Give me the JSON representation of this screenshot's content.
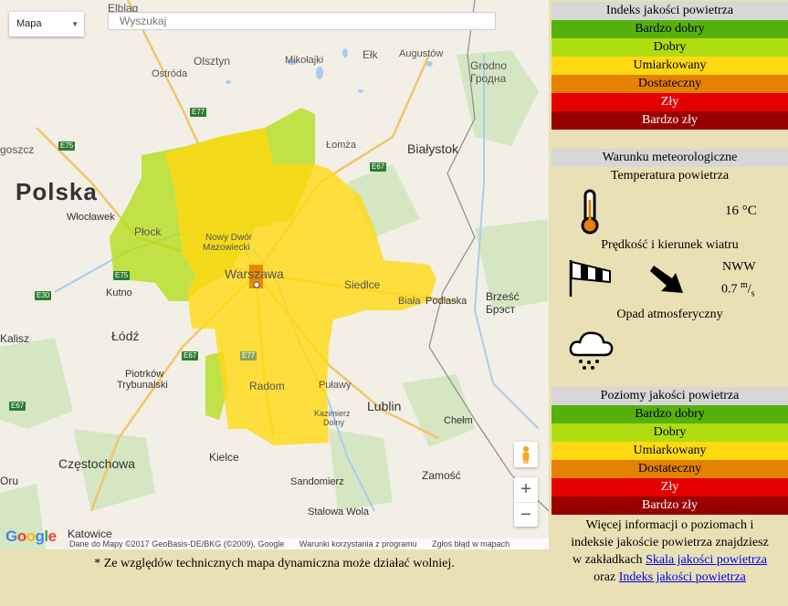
{
  "map": {
    "map_type": "Mapa",
    "search_placeholder": "Wyszukaj",
    "attribution": [
      "Dane do Mapy ©2017 GeoBasis-DE/BKG (©2009), Google",
      "Warunki korzystania z programu",
      "Zgłoś błąd w mapach"
    ],
    "logo": "Google",
    "zoom_in": "+",
    "zoom_out": "−",
    "labels": {
      "elblag": "Elbląg",
      "olsztyn": "Olsztyn",
      "mikolajki": "Mikołajki",
      "elk": "Ełk",
      "augustow": "Augustów",
      "grodno": "Grodno",
      "grodno_ru": "Гродна",
      "ostroda": "Ostróda",
      "goszcz": "goszcz",
      "lomza": "Łomża",
      "bialystok": "Białystok",
      "polska": "Polska",
      "wloclawek": "Włocławek",
      "plock": "Płock",
      "nowy_dwor": "Nowy Dwór",
      "mazowiecki": "Mazowiecki",
      "warszawa": "Warszawa",
      "siedlce": "Siedlce",
      "kutno": "Kutno",
      "biala": "Biała",
      "podlaska": "Podlaska",
      "brzesc": "Brześć",
      "brest_ru": "Брэст",
      "kalisz": "Kalisz",
      "lodz": "Łódź",
      "piotrkow": "Piotrków",
      "trybunalski": "Trybunalski",
      "radom": "Radom",
      "pulawy": "Puławy",
      "lublin": "Lublin",
      "kazimierz": "Kazimierz",
      "dolny": "Dolny",
      "chelm": "Chełm",
      "kielce": "Kielce",
      "czestochowa": "Częstochowa",
      "zamosc": "Zamość",
      "sandomierz": "Sandomierz",
      "stalowa": "Stalowa Wola",
      "katowice": "Katowice",
      "oru": "Oru"
    },
    "roads": {
      "e77a": "E77",
      "e75": "E75",
      "e67a": "E67",
      "e75b": "E75",
      "e30": "E30",
      "e67b": "E67",
      "e77b": "E77",
      "e67c": "E67"
    }
  },
  "note": "* Ze względów technicznych mapa dynamiczna może działać wolniej.",
  "index": {
    "title": "Indeks jakości powietrza",
    "levels": [
      "Bardzo dobry",
      "Dobry",
      "Umiarkowany",
      "Dostateczny",
      "Zły",
      "Bardzo zły"
    ]
  },
  "colors": [
    "#57b10d",
    "#b0dd10",
    "#ffd912",
    "#e58100",
    "#e50000",
    "#990000"
  ],
  "meteo": {
    "title": "Warunku meteorologiczne",
    "temp_title": "Temperatura powietrza",
    "temp_value": "16 °C",
    "wind_title": "Prędkość i kierunek wiatru",
    "wind_dir": "NWW",
    "wind_speed": "0.7",
    "wind_unit_num": "m",
    "wind_unit_den": "s",
    "rain_title": "Opad atmosferyczny"
  },
  "levels": {
    "title": "Poziomy jakości powietrza",
    "items": [
      "Bardzo dobry",
      "Dobry",
      "Umiarkowany",
      "Dostateczny",
      "Zły",
      "Bardzo zły"
    ]
  },
  "info": {
    "line1": "Więcej informacji o poziomach i",
    "line2": "indeksie jakoście powietrza znajdziesz",
    "line3_pre": "w zakładkach",
    "link1": "Skala jakości powietrza",
    "line4_pre": "oraz",
    "link2": "Indeks jakości powietrza"
  }
}
